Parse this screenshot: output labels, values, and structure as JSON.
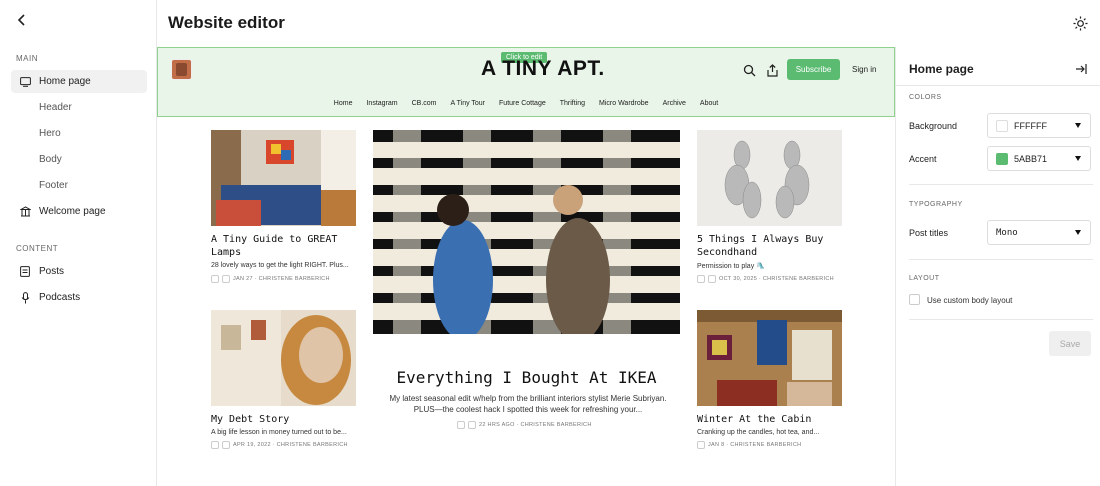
{
  "app": {
    "title": "Website editor"
  },
  "sidebar": {
    "main_label": "MAIN",
    "content_label": "CONTENT",
    "items": [
      {
        "label": "Home page"
      },
      {
        "label": "Header"
      },
      {
        "label": "Hero"
      },
      {
        "label": "Body"
      },
      {
        "label": "Footer"
      },
      {
        "label": "Welcome page"
      }
    ],
    "content_items": [
      {
        "label": "Posts"
      },
      {
        "label": "Podcasts"
      }
    ]
  },
  "preview": {
    "tooltip": "Click to edit",
    "brand": "A TINY APT.",
    "subscribe": "Subscribe",
    "signin": "Sign in",
    "menu": [
      "Home",
      "Instagram",
      "CB.com",
      "A Tiny Tour",
      "Future Cottage",
      "Thrifting",
      "Micro Wardrobe",
      "Archive",
      "About"
    ],
    "posts": [
      {
        "title": "A Tiny Guide to GREAT Lamps",
        "excerpt": "28 lovely ways to get the light RIGHT. Plus...",
        "meta": "JAN 27 · CHRISTENE BARBERICH"
      },
      {
        "title": "My Debt Story",
        "excerpt": "A big life lesson in money turned out to be...",
        "meta": "APR 19, 2022 · CHRISTENE BARBERICH"
      },
      {
        "title": "5 Things I Always Buy Secondhand",
        "excerpt": "Permission to play 🛝",
        "meta": "OCT 30, 2025 · CHRISTENE BARBERICH"
      },
      {
        "title": "Winter At the Cabin",
        "excerpt": "Cranking up the candles, hot tea, and...",
        "meta": "JAN 8 · CHRISTENE BARBERICH"
      }
    ],
    "featured": {
      "title": "Everything I Bought At IKEA",
      "excerpt": "My latest seasonal edit w/help from the brilliant interiors stylist Merie Subriyan. PLUS—the coolest hack I spotted this week for refreshing your...",
      "meta": "22 HRS AGO · CHRISTENE BARBERICH"
    }
  },
  "panel": {
    "title": "Home page",
    "colors_label": "COLORS",
    "background_label": "Background",
    "background_value": "FFFFFF",
    "accent_label": "Accent",
    "accent_value": "5ABB71",
    "typography_label": "TYPOGRAPHY",
    "post_titles_label": "Post titles",
    "post_titles_value": "Mono",
    "layout_label": "LAYOUT",
    "custom_layout_label": "Use custom body layout",
    "save": "Save"
  },
  "colors": {
    "accent": "#5ABB71",
    "background": "#FFFFFF"
  }
}
